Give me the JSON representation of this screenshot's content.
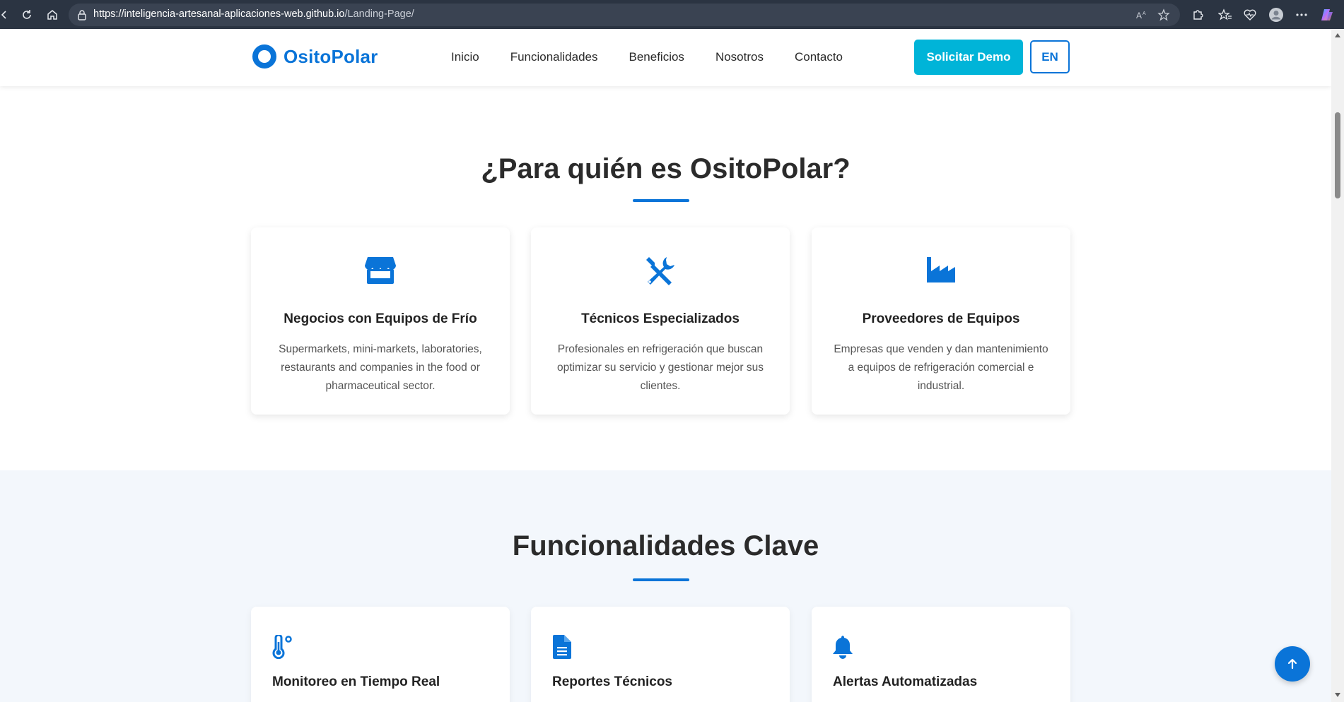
{
  "browser": {
    "url_host": "https://inteligencia-artesanal-aplicaciones-web.github.io",
    "url_path": "/Landing-Page/"
  },
  "header": {
    "logo_text": "OsitoPolar",
    "nav": [
      "Inicio",
      "Funcionalidades",
      "Beneficios",
      "Nosotros",
      "Contacto"
    ],
    "demo_button": "Solicitar Demo",
    "lang_button": "EN"
  },
  "audience": {
    "title": "¿Para quién es OsitoPolar?",
    "cards": [
      {
        "icon": "store-icon",
        "title": "Negocios con Equipos de Frío",
        "text": "Supermarkets, mini-markets, laboratories, restaurants and companies in the food or pharmaceutical sector."
      },
      {
        "icon": "tools-icon",
        "title": "Técnicos Especializados",
        "text": "Profesionales en refrigeración que buscan optimizar su servicio y gestionar mejor sus clientes."
      },
      {
        "icon": "industry-icon",
        "title": "Proveedores de Equipos",
        "text": "Empresas que venden y dan mantenimiento a equipos de refrigeración comercial e industrial."
      }
    ]
  },
  "features": {
    "title": "Funcionalidades Clave",
    "cards": [
      {
        "icon": "thermometer-icon",
        "title": "Monitoreo en Tiempo Real"
      },
      {
        "icon": "document-icon",
        "title": "Reportes Técnicos"
      },
      {
        "icon": "bell-icon",
        "title": "Alertas Automatizadas"
      }
    ]
  },
  "colors": {
    "primary": "#0a74d8",
    "accent": "#00b4d8",
    "features_bg": "#f3f7fc"
  }
}
